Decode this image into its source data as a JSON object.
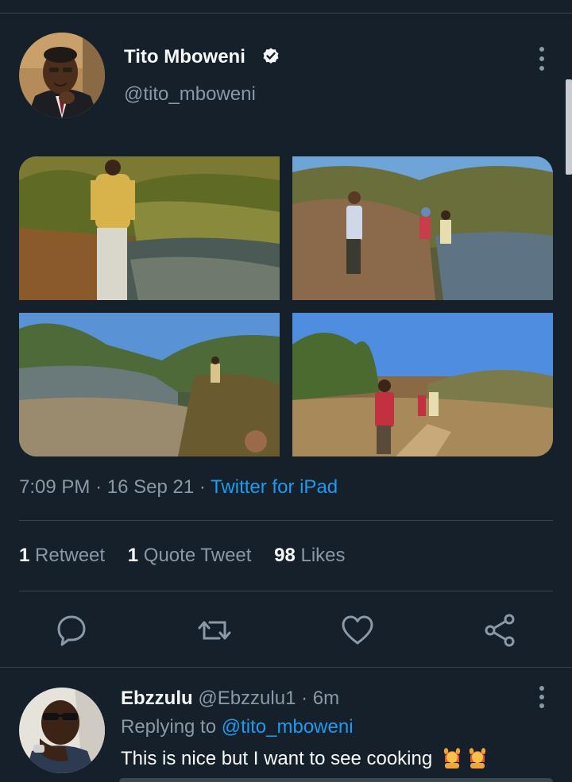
{
  "tweet": {
    "author": {
      "name": "Tito Mboweni",
      "handle": "@tito_mboweni",
      "verified": true
    },
    "media_count": 4,
    "time": "7:09 PM",
    "date": "16 Sep 21",
    "source": "Twitter for iPad",
    "separator": "·",
    "stats": {
      "retweets_count": "1",
      "retweets_label": "Retweet",
      "quotes_count": "1",
      "quotes_label": "Quote Tweet",
      "likes_count": "98",
      "likes_label": "Likes"
    }
  },
  "reply": {
    "name": "Ebzzulu",
    "handle": "@Ebzzulu1",
    "time": "6m",
    "replying_prefix": "Replying to",
    "replying_to": "@tito_mboweni",
    "text": "This is nice but I want to see cooking"
  },
  "colors": {
    "background": "#15202b",
    "accent": "#1d9bf0",
    "secondary_text": "#8b98a5",
    "divider": "#38444d"
  }
}
